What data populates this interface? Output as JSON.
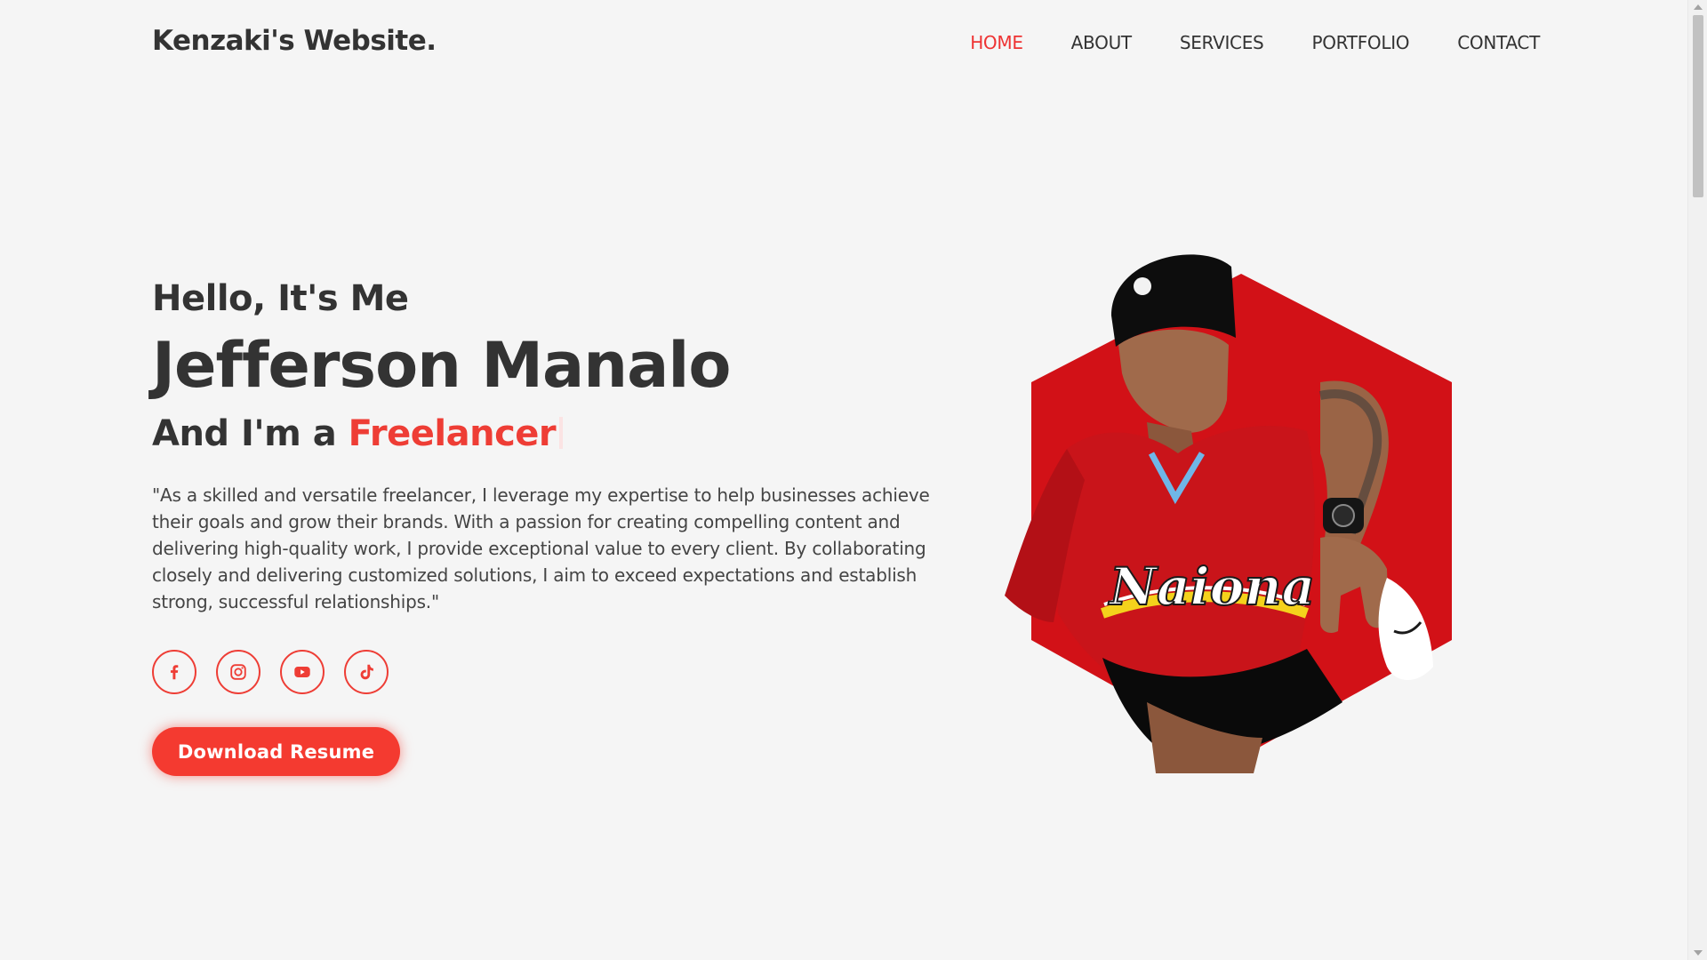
{
  "header": {
    "logo": "Kenzaki's Website.",
    "nav": [
      {
        "label": "HOME",
        "active": true
      },
      {
        "label": "ABOUT",
        "active": false
      },
      {
        "label": "SERVICES",
        "active": false
      },
      {
        "label": "PORTFOLIO",
        "active": false
      },
      {
        "label": "CONTACT",
        "active": false
      }
    ]
  },
  "hero": {
    "greeting": "Hello, It's Me",
    "name": "Jefferson Manalo",
    "role_prefix": "And I'm a",
    "role_highlight": "Freelancer",
    "bio": "\"As a skilled and versatile freelancer, I leverage my expertise to help businesses achieve their goals and grow their brands. With a passion for creating compelling content and delivering high-quality work, I provide exceptional value to every client. By collaborating closely and delivering customized solutions, I aim to exceed expectations and establish strong, successful relationships.\"",
    "socials": [
      {
        "icon": "facebook-icon"
      },
      {
        "icon": "instagram-icon"
      },
      {
        "icon": "youtube-icon"
      },
      {
        "icon": "tiktok-icon"
      }
    ],
    "button_label": "Download Resume",
    "image": {
      "shape": "hexagon",
      "jersey_text": "Naiona"
    }
  },
  "colors": {
    "background": "#f5f5f5",
    "accent": "#ee3d35",
    "text": "#333333",
    "hexagon": "#d21117"
  }
}
